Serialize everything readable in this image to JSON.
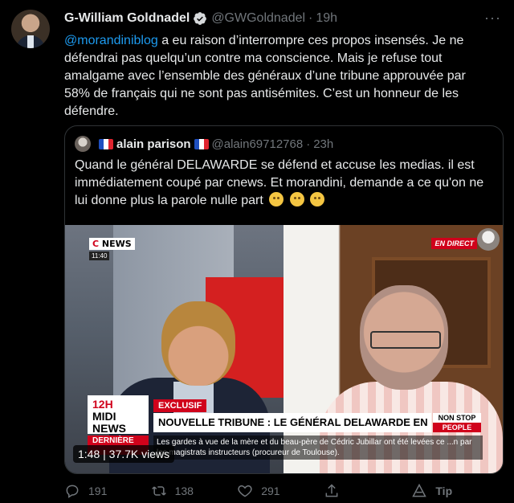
{
  "tweet": {
    "author_name": "G-William Goldnadel",
    "handle": "@GWGoldnadel",
    "separator": "·",
    "time": "19h",
    "mention": "@morandiniblog",
    "text": " a eu raison d’interrompre ces propos insensés. Je ne défendrai pas quelqu’un contre ma conscience. Mais je refuse tout amalgame avec l’ensemble des généraux d’une tribune approuvée par 58% de français qui ne sont pas antisémites. C’est un honneur de les défendre.",
    "more_icon": "···"
  },
  "quote": {
    "author_name": "alain parison",
    "handle": "@alain69712768",
    "separator": "·",
    "time": "23h",
    "text": "Quand le général DELAWARDE se défend et accuse les medias. il est immédiatement coupé par cnews. Et morandini, demande a ce qu'on ne lui donne plus la parole nulle part"
  },
  "video": {
    "channel_logo_c": "C",
    "channel_logo_news": "NEWS",
    "clock": "11:40",
    "live_badge": "EN DIRECT",
    "show_line1": "12H",
    "show_line2": "MIDI",
    "show_line3": "NEWS",
    "exclusive": "EXCLUSIF",
    "headline": "NOUVELLE TRIBUNE : LE GÉNÉRAL DELAWARDE EN DIRECT",
    "nonstop_line1": "NON STOP",
    "nonstop_line2": "PEOPLE",
    "dernier": "DERNIÈRE",
    "ticker": "Les gardes à vue de la mère et du beau-père de Cédric Jubillar ont été levées ce ...n par les magistrats instructeurs (procureur de Toulouse).",
    "duration_views": "1:48 | 37.7K views"
  },
  "actions": {
    "reply_count": "191",
    "retweet_count": "138",
    "like_count": "291",
    "tip_label": "Tip"
  },
  "colors": {
    "accent": "#1d9bf0",
    "muted": "#71767b",
    "cnews_red": "#d0021b"
  }
}
